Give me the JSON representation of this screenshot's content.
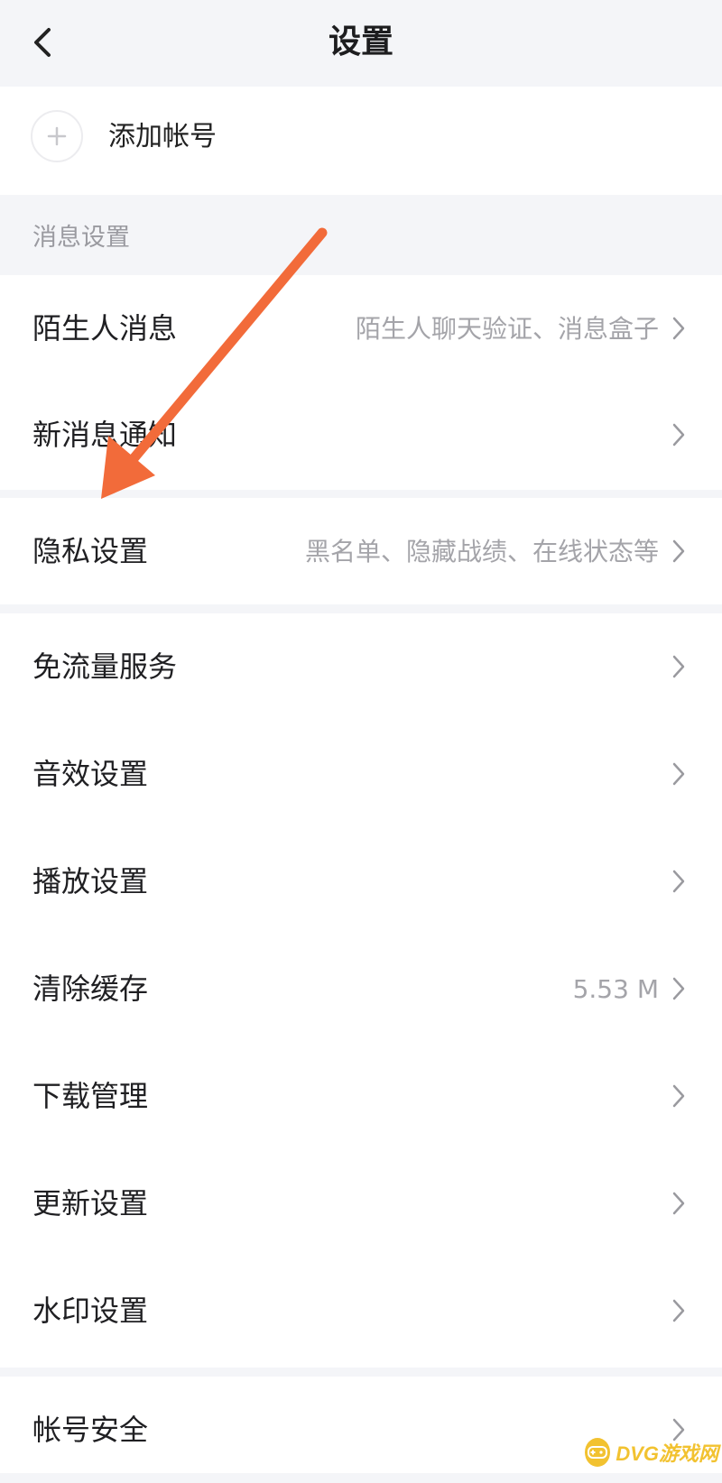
{
  "header": {
    "title": "设置",
    "back_icon": "chevron-left-icon"
  },
  "add_account": {
    "label": "添加帐号",
    "icon": "plus-icon"
  },
  "message_group": {
    "label": "消息设置"
  },
  "rows": [
    {
      "label": "陌生人消息",
      "value": "陌生人聊天验证、消息盒子"
    },
    {
      "label": "新消息通知",
      "value": ""
    },
    {
      "label": "隐私设置",
      "value": "黑名单、隐藏战绩、在线状态等"
    },
    {
      "label": "免流量服务",
      "value": ""
    },
    {
      "label": "音效设置",
      "value": ""
    },
    {
      "label": "播放设置",
      "value": ""
    },
    {
      "label": "清除缓存",
      "value": "5.53 M"
    },
    {
      "label": "下载管理",
      "value": ""
    },
    {
      "label": "更新设置",
      "value": ""
    },
    {
      "label": "水印设置",
      "value": ""
    },
    {
      "label": "帐号安全",
      "value": ""
    }
  ],
  "annotation": {
    "arrow_color": "#f26b3a"
  },
  "watermark": {
    "text": "DVG游戏网"
  },
  "colors": {
    "background": "#f4f5f8",
    "card": "#ffffff",
    "secondary_text": "#a4a4a9",
    "watermark": "#f2c230"
  }
}
